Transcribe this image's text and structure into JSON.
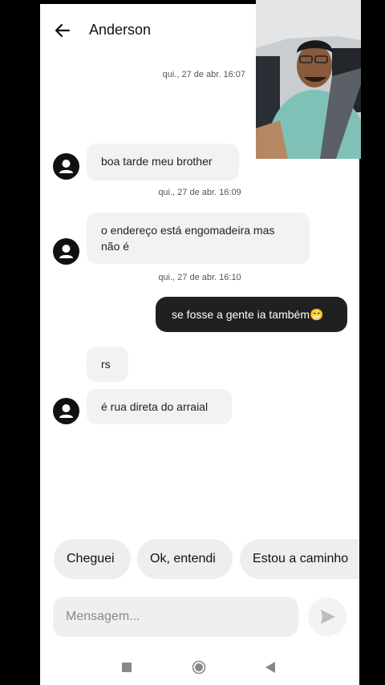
{
  "header": {
    "contact_name": "Anderson"
  },
  "messages": [
    {
      "timestamp": "qui., 27 de abr. 16:07"
    },
    {
      "text": "boa tarde meu brother"
    },
    {
      "timestamp": "qui., 27 de abr. 16:09"
    },
    {
      "text": "o endereço está engomadeira mas não é"
    },
    {
      "timestamp": "qui., 27 de abr. 16:10"
    },
    {
      "text": "se fosse a gente ia também😁"
    },
    {
      "text": "rs"
    },
    {
      "text": "é rua direta do arraial"
    }
  ],
  "quick_replies": [
    "Cheguei",
    "Ok, entendi",
    "Estou a caminho"
  ],
  "composer": {
    "placeholder": "Mensagem..."
  },
  "icons": {
    "back": "arrow-left-icon",
    "avatar": "person-icon",
    "send": "send-icon",
    "nav_recents": "square-icon",
    "nav_home": "circle-icon",
    "nav_back": "triangle-icon"
  }
}
